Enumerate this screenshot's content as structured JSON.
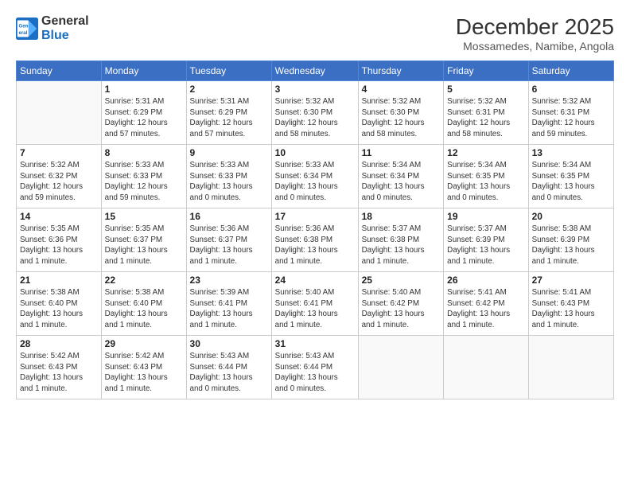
{
  "logo": {
    "line1": "General",
    "line2": "Blue"
  },
  "title": "December 2025",
  "location": "Mossamedes, Namibe, Angola",
  "header_days": [
    "Sunday",
    "Monday",
    "Tuesday",
    "Wednesday",
    "Thursday",
    "Friday",
    "Saturday"
  ],
  "weeks": [
    [
      {
        "day": "",
        "info": ""
      },
      {
        "day": "1",
        "info": "Sunrise: 5:31 AM\nSunset: 6:29 PM\nDaylight: 12 hours\nand 57 minutes."
      },
      {
        "day": "2",
        "info": "Sunrise: 5:31 AM\nSunset: 6:29 PM\nDaylight: 12 hours\nand 57 minutes."
      },
      {
        "day": "3",
        "info": "Sunrise: 5:32 AM\nSunset: 6:30 PM\nDaylight: 12 hours\nand 58 minutes."
      },
      {
        "day": "4",
        "info": "Sunrise: 5:32 AM\nSunset: 6:30 PM\nDaylight: 12 hours\nand 58 minutes."
      },
      {
        "day": "5",
        "info": "Sunrise: 5:32 AM\nSunset: 6:31 PM\nDaylight: 12 hours\nand 58 minutes."
      },
      {
        "day": "6",
        "info": "Sunrise: 5:32 AM\nSunset: 6:31 PM\nDaylight: 12 hours\nand 59 minutes."
      }
    ],
    [
      {
        "day": "7",
        "info": "Sunrise: 5:32 AM\nSunset: 6:32 PM\nDaylight: 12 hours\nand 59 minutes."
      },
      {
        "day": "8",
        "info": "Sunrise: 5:33 AM\nSunset: 6:33 PM\nDaylight: 12 hours\nand 59 minutes."
      },
      {
        "day": "9",
        "info": "Sunrise: 5:33 AM\nSunset: 6:33 PM\nDaylight: 13 hours\nand 0 minutes."
      },
      {
        "day": "10",
        "info": "Sunrise: 5:33 AM\nSunset: 6:34 PM\nDaylight: 13 hours\nand 0 minutes."
      },
      {
        "day": "11",
        "info": "Sunrise: 5:34 AM\nSunset: 6:34 PM\nDaylight: 13 hours\nand 0 minutes."
      },
      {
        "day": "12",
        "info": "Sunrise: 5:34 AM\nSunset: 6:35 PM\nDaylight: 13 hours\nand 0 minutes."
      },
      {
        "day": "13",
        "info": "Sunrise: 5:34 AM\nSunset: 6:35 PM\nDaylight: 13 hours\nand 0 minutes."
      }
    ],
    [
      {
        "day": "14",
        "info": "Sunrise: 5:35 AM\nSunset: 6:36 PM\nDaylight: 13 hours\nand 1 minute."
      },
      {
        "day": "15",
        "info": "Sunrise: 5:35 AM\nSunset: 6:37 PM\nDaylight: 13 hours\nand 1 minute."
      },
      {
        "day": "16",
        "info": "Sunrise: 5:36 AM\nSunset: 6:37 PM\nDaylight: 13 hours\nand 1 minute."
      },
      {
        "day": "17",
        "info": "Sunrise: 5:36 AM\nSunset: 6:38 PM\nDaylight: 13 hours\nand 1 minute."
      },
      {
        "day": "18",
        "info": "Sunrise: 5:37 AM\nSunset: 6:38 PM\nDaylight: 13 hours\nand 1 minute."
      },
      {
        "day": "19",
        "info": "Sunrise: 5:37 AM\nSunset: 6:39 PM\nDaylight: 13 hours\nand 1 minute."
      },
      {
        "day": "20",
        "info": "Sunrise: 5:38 AM\nSunset: 6:39 PM\nDaylight: 13 hours\nand 1 minute."
      }
    ],
    [
      {
        "day": "21",
        "info": "Sunrise: 5:38 AM\nSunset: 6:40 PM\nDaylight: 13 hours\nand 1 minute."
      },
      {
        "day": "22",
        "info": "Sunrise: 5:38 AM\nSunset: 6:40 PM\nDaylight: 13 hours\nand 1 minute."
      },
      {
        "day": "23",
        "info": "Sunrise: 5:39 AM\nSunset: 6:41 PM\nDaylight: 13 hours\nand 1 minute."
      },
      {
        "day": "24",
        "info": "Sunrise: 5:40 AM\nSunset: 6:41 PM\nDaylight: 13 hours\nand 1 minute."
      },
      {
        "day": "25",
        "info": "Sunrise: 5:40 AM\nSunset: 6:42 PM\nDaylight: 13 hours\nand 1 minute."
      },
      {
        "day": "26",
        "info": "Sunrise: 5:41 AM\nSunset: 6:42 PM\nDaylight: 13 hours\nand 1 minute."
      },
      {
        "day": "27",
        "info": "Sunrise: 5:41 AM\nSunset: 6:43 PM\nDaylight: 13 hours\nand 1 minute."
      }
    ],
    [
      {
        "day": "28",
        "info": "Sunrise: 5:42 AM\nSunset: 6:43 PM\nDaylight: 13 hours\nand 1 minute."
      },
      {
        "day": "29",
        "info": "Sunrise: 5:42 AM\nSunset: 6:43 PM\nDaylight: 13 hours\nand 1 minute."
      },
      {
        "day": "30",
        "info": "Sunrise: 5:43 AM\nSunset: 6:44 PM\nDaylight: 13 hours\nand 0 minutes."
      },
      {
        "day": "31",
        "info": "Sunrise: 5:43 AM\nSunset: 6:44 PM\nDaylight: 13 hours\nand 0 minutes."
      },
      {
        "day": "",
        "info": ""
      },
      {
        "day": "",
        "info": ""
      },
      {
        "day": "",
        "info": ""
      }
    ]
  ]
}
